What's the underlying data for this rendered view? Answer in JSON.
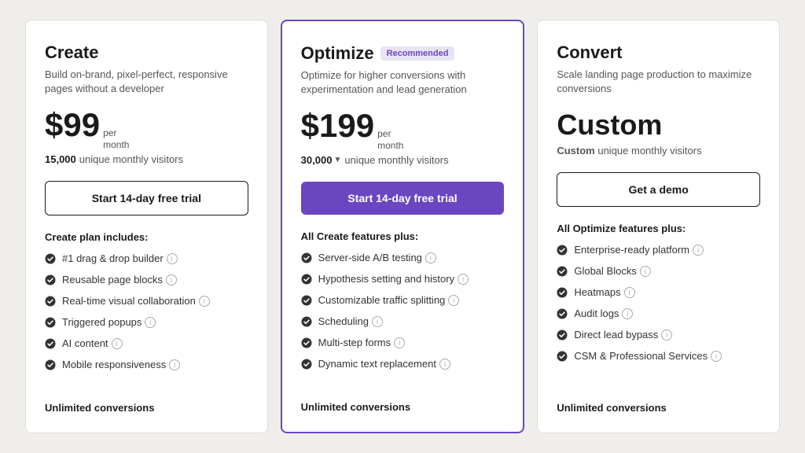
{
  "plans": [
    {
      "id": "create",
      "title": "Create",
      "description": "Build on-brand, pixel-perfect, responsive pages without a developer",
      "price": "$99",
      "price_label": "per\nmonth",
      "visitors_number": "15,000",
      "visitors_label": "unique monthly visitors",
      "cta_label": "Start 14-day free trial",
      "cta_type": "outline",
      "features_title": "Create plan includes:",
      "features": [
        "#1 drag & drop builder",
        "Reusable page blocks",
        "Real-time visual collaboration",
        "Triggered popups",
        "AI content",
        "Mobile responsiveness"
      ],
      "unlimited_label": "Unlimited conversions",
      "featured": false,
      "recommended": false
    },
    {
      "id": "optimize",
      "title": "Optimize",
      "description": "Optimize for higher conversions with experimentation and lead generation",
      "price": "$199",
      "price_label": "per\nmonth",
      "visitors_number": "30,000",
      "visitors_label": "unique monthly visitors",
      "cta_label": "Start 14-day free trial",
      "cta_type": "primary",
      "features_title": "All Create features plus:",
      "features": [
        "Server-side A/B testing",
        "Hypothesis setting and history",
        "Customizable traffic splitting",
        "Scheduling",
        "Multi-step forms",
        "Dynamic text replacement"
      ],
      "unlimited_label": "Unlimited conversions",
      "featured": true,
      "recommended": true,
      "recommended_label": "Recommended"
    },
    {
      "id": "convert",
      "title": "Convert",
      "description": "Scale landing page production to maximize conversions",
      "price": "Custom",
      "price_label": "",
      "visitors_label": "Custom unique monthly visitors",
      "cta_label": "Get a demo",
      "cta_type": "outline",
      "features_title": "All Optimize features plus:",
      "features": [
        "Enterprise-ready platform",
        "Global Blocks",
        "Heatmaps",
        "Audit logs",
        "Direct lead bypass",
        "CSM & Professional Services"
      ],
      "unlimited_label": "Unlimited conversions",
      "featured": false,
      "recommended": false
    }
  ]
}
